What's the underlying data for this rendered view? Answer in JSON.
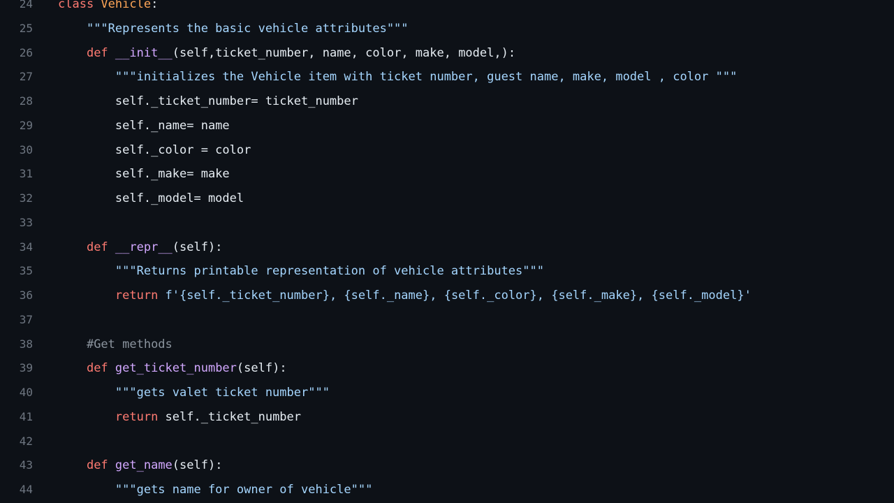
{
  "colors": {
    "background": "#0d1117",
    "line_number": "#6e7681",
    "keyword": "#ff7b72",
    "function": "#d2a8ff",
    "class_name": "#ffa657",
    "string": "#a5d6ff",
    "comment": "#8b949e",
    "text": "#e6edf3"
  },
  "lines": [
    {
      "n": "24",
      "indent": "",
      "tokens": [
        [
          "kw",
          "class "
        ],
        [
          "cls",
          "Vehicle"
        ],
        [
          "pl",
          ":"
        ]
      ]
    },
    {
      "n": "25",
      "indent": "    ",
      "tokens": [
        [
          "str",
          "\"\"\"Represents the basic vehicle attributes\"\"\""
        ]
      ]
    },
    {
      "n": "26",
      "indent": "    ",
      "tokens": [
        [
          "kw",
          "def "
        ],
        [
          "fn",
          "__init__"
        ],
        [
          "pl",
          "(self,ticket_number, name, color, make, model,):"
        ]
      ]
    },
    {
      "n": "27",
      "indent": "        ",
      "tokens": [
        [
          "str",
          "\"\"\"initializes the Vehicle item with ticket number, guest name, make, model , color \"\"\""
        ]
      ]
    },
    {
      "n": "28",
      "indent": "        ",
      "tokens": [
        [
          "pl",
          "self._ticket_number= ticket_number"
        ]
      ]
    },
    {
      "n": "29",
      "indent": "        ",
      "tokens": [
        [
          "pl",
          "self._name= name"
        ]
      ]
    },
    {
      "n": "30",
      "indent": "        ",
      "tokens": [
        [
          "pl",
          "self._color = color"
        ]
      ]
    },
    {
      "n": "31",
      "indent": "        ",
      "tokens": [
        [
          "pl",
          "self._make= make"
        ]
      ]
    },
    {
      "n": "32",
      "indent": "        ",
      "tokens": [
        [
          "pl",
          "self._model= model"
        ]
      ]
    },
    {
      "n": "33",
      "indent": "",
      "tokens": []
    },
    {
      "n": "34",
      "indent": "    ",
      "tokens": [
        [
          "kw",
          "def "
        ],
        [
          "fn",
          "__repr__"
        ],
        [
          "pl",
          "(self):"
        ]
      ]
    },
    {
      "n": "35",
      "indent": "        ",
      "tokens": [
        [
          "str",
          "\"\"\"Returns printable representation of vehicle attributes\"\"\""
        ]
      ]
    },
    {
      "n": "36",
      "indent": "        ",
      "tokens": [
        [
          "kw",
          "return "
        ],
        [
          "str",
          "f'{self._ticket_number}, {self._name}, {self._color}, {self._make}, {self._model}'"
        ]
      ]
    },
    {
      "n": "37",
      "indent": "",
      "tokens": []
    },
    {
      "n": "38",
      "indent": "    ",
      "tokens": [
        [
          "cmt",
          "#Get methods"
        ]
      ]
    },
    {
      "n": "39",
      "indent": "    ",
      "tokens": [
        [
          "kw",
          "def "
        ],
        [
          "fn",
          "get_ticket_number"
        ],
        [
          "pl",
          "(self):"
        ]
      ]
    },
    {
      "n": "40",
      "indent": "        ",
      "tokens": [
        [
          "str",
          "\"\"\"gets valet ticket number\"\"\""
        ]
      ]
    },
    {
      "n": "41",
      "indent": "        ",
      "tokens": [
        [
          "kw",
          "return "
        ],
        [
          "pl",
          "self._ticket_number"
        ]
      ]
    },
    {
      "n": "42",
      "indent": "",
      "tokens": []
    },
    {
      "n": "43",
      "indent": "    ",
      "tokens": [
        [
          "kw",
          "def "
        ],
        [
          "fn",
          "get_name"
        ],
        [
          "pl",
          "(self):"
        ]
      ]
    },
    {
      "n": "44",
      "indent": "        ",
      "tokens": [
        [
          "str",
          "\"\"\"gets name for owner of vehicle\"\"\""
        ]
      ]
    }
  ]
}
